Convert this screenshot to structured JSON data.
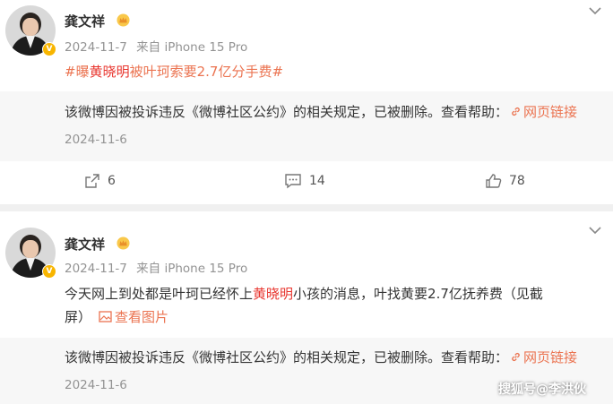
{
  "posts": [
    {
      "author": "龚文祥",
      "date": "2024-11-7",
      "source": "来自 iPhone 15 Pro",
      "topic_prefix": "#曝",
      "topic_highlight": "黄晓明",
      "topic_suffix": "被叶珂索要2.7亿分手费#",
      "quote": {
        "text": "该微博因被投诉违反《微博社区公约》的相关规定，已被删除。查看帮助：",
        "link": "网页链接",
        "date": "2024-11-6"
      },
      "actions": {
        "repost": "6",
        "comment": "14",
        "like": "78"
      }
    },
    {
      "author": "龚文祥",
      "date": "2024-11-7",
      "source": "来自 iPhone 15 Pro",
      "text_prefix": "今天网上到处都是叶珂已经怀上",
      "text_highlight": "黄晓明",
      "text_suffix": "小孩的消息，叶找黄要2.7亿抚养费（见截",
      "text_line2": "屏）",
      "image_link": "查看图片",
      "quote": {
        "text": "该微博因被投诉违反《微博社区公约》的相关规定，已被删除。查看帮助：",
        "link": "网页链接",
        "date": "2024-11-6"
      }
    }
  ],
  "watermark": "搜狐号@李洪伙",
  "colors": {
    "link": "#eb7350",
    "highlight": "#e8352e",
    "badge": "#f8b500"
  },
  "icons": [
    "chevron-down-icon",
    "crown-icon",
    "verified-badge-icon",
    "link-icon",
    "repost-icon",
    "comment-icon",
    "like-icon",
    "image-icon"
  ]
}
